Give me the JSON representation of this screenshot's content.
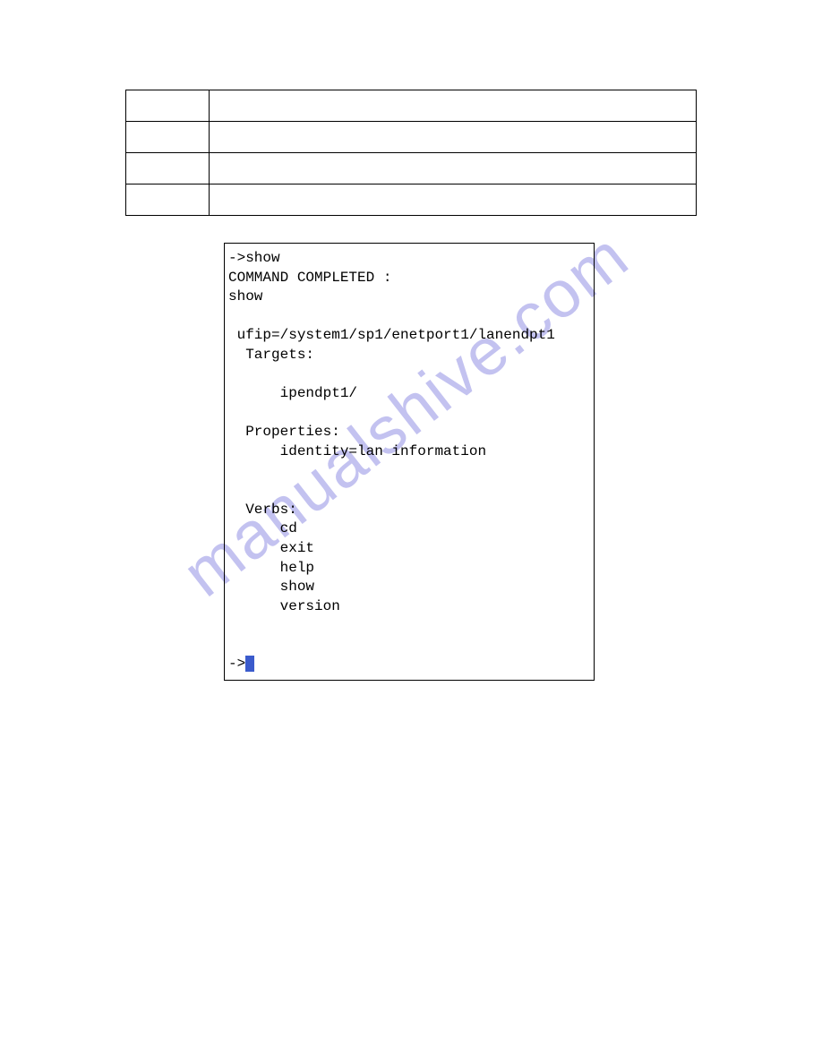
{
  "table": {
    "rows": [
      {
        "c1": "",
        "c2": ""
      },
      {
        "c1": "",
        "c2": ""
      },
      {
        "c1": "",
        "c2": ""
      },
      {
        "c1": "",
        "c2": ""
      }
    ]
  },
  "terminal": {
    "line01": "->show",
    "line02": "COMMAND COMPLETED :",
    "line03": "show",
    "line05": " ufip=/system1/sp1/enetport1/lanendpt1",
    "line06": "  Targets:",
    "line08": "      ipendpt1/",
    "line10": "  Properties:",
    "line11": "      identity=lan information",
    "line14": "  Verbs:",
    "line15": "      cd",
    "line16": "      exit",
    "line17": "      help",
    "line18": "      show",
    "line19": "      version",
    "prompt": "->"
  },
  "watermark": "manualshive.com"
}
